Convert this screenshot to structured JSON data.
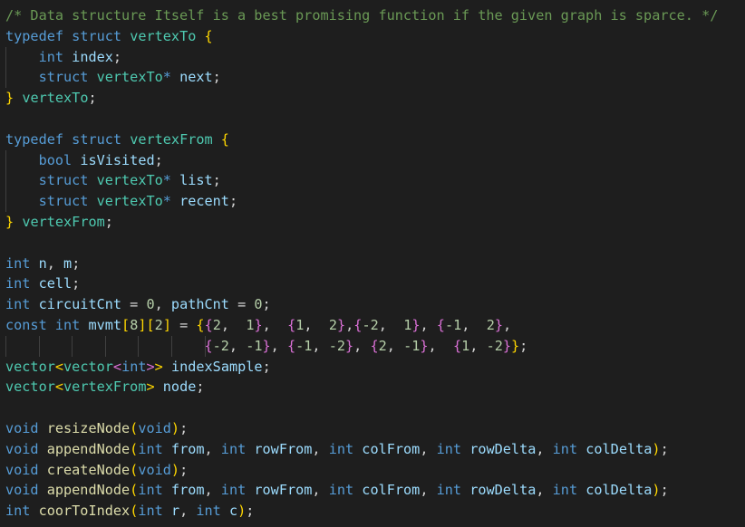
{
  "code": {
    "language": "cpp",
    "lines": [
      {
        "tokens": [
          {
            "c": "comment",
            "t": "/* Data structure Itself is a best promising function if the given graph is sparce. */"
          }
        ]
      },
      {
        "tokens": [
          {
            "c": "kw",
            "t": "typedef"
          },
          {
            "c": "punct",
            "t": " "
          },
          {
            "c": "kw",
            "t": "struct"
          },
          {
            "c": "punct",
            "t": " "
          },
          {
            "c": "type",
            "t": "vertexTo"
          },
          {
            "c": "punct",
            "t": " "
          },
          {
            "c": "b1",
            "t": "{"
          }
        ]
      },
      {
        "guides": [
          1
        ],
        "tokens": [
          {
            "c": "punct",
            "t": "    "
          },
          {
            "c": "kw",
            "t": "int"
          },
          {
            "c": "punct",
            "t": " "
          },
          {
            "c": "ident",
            "t": "index"
          },
          {
            "c": "punct",
            "t": ";"
          }
        ]
      },
      {
        "guides": [
          1
        ],
        "tokens": [
          {
            "c": "punct",
            "t": "    "
          },
          {
            "c": "kw",
            "t": "struct"
          },
          {
            "c": "punct",
            "t": " "
          },
          {
            "c": "type",
            "t": "vertexTo"
          },
          {
            "c": "kw",
            "t": "*"
          },
          {
            "c": "punct",
            "t": " "
          },
          {
            "c": "ident",
            "t": "next"
          },
          {
            "c": "punct",
            "t": ";"
          }
        ]
      },
      {
        "tokens": [
          {
            "c": "b1",
            "t": "}"
          },
          {
            "c": "punct",
            "t": " "
          },
          {
            "c": "type",
            "t": "vertexTo"
          },
          {
            "c": "punct",
            "t": ";"
          }
        ]
      },
      {
        "tokens": []
      },
      {
        "tokens": [
          {
            "c": "kw",
            "t": "typedef"
          },
          {
            "c": "punct",
            "t": " "
          },
          {
            "c": "kw",
            "t": "struct"
          },
          {
            "c": "punct",
            "t": " "
          },
          {
            "c": "type",
            "t": "vertexFrom"
          },
          {
            "c": "punct",
            "t": " "
          },
          {
            "c": "b1",
            "t": "{"
          }
        ]
      },
      {
        "guides": [
          1
        ],
        "tokens": [
          {
            "c": "punct",
            "t": "    "
          },
          {
            "c": "kw",
            "t": "bool"
          },
          {
            "c": "punct",
            "t": " "
          },
          {
            "c": "ident",
            "t": "isVisited"
          },
          {
            "c": "punct",
            "t": ";"
          }
        ]
      },
      {
        "guides": [
          1
        ],
        "tokens": [
          {
            "c": "punct",
            "t": "    "
          },
          {
            "c": "kw",
            "t": "struct"
          },
          {
            "c": "punct",
            "t": " "
          },
          {
            "c": "type",
            "t": "vertexTo"
          },
          {
            "c": "kw",
            "t": "*"
          },
          {
            "c": "punct",
            "t": " "
          },
          {
            "c": "ident",
            "t": "list"
          },
          {
            "c": "punct",
            "t": ";"
          }
        ]
      },
      {
        "guides": [
          1
        ],
        "tokens": [
          {
            "c": "punct",
            "t": "    "
          },
          {
            "c": "kw",
            "t": "struct"
          },
          {
            "c": "punct",
            "t": " "
          },
          {
            "c": "type",
            "t": "vertexTo"
          },
          {
            "c": "kw",
            "t": "*"
          },
          {
            "c": "punct",
            "t": " "
          },
          {
            "c": "ident",
            "t": "recent"
          },
          {
            "c": "punct",
            "t": ";"
          }
        ]
      },
      {
        "tokens": [
          {
            "c": "b1",
            "t": "}"
          },
          {
            "c": "punct",
            "t": " "
          },
          {
            "c": "type",
            "t": "vertexFrom"
          },
          {
            "c": "punct",
            "t": ";"
          }
        ]
      },
      {
        "tokens": []
      },
      {
        "tokens": [
          {
            "c": "kw",
            "t": "int"
          },
          {
            "c": "punct",
            "t": " "
          },
          {
            "c": "ident",
            "t": "n"
          },
          {
            "c": "punct",
            "t": ", "
          },
          {
            "c": "ident",
            "t": "m"
          },
          {
            "c": "punct",
            "t": ";"
          }
        ]
      },
      {
        "tokens": [
          {
            "c": "kw",
            "t": "int"
          },
          {
            "c": "punct",
            "t": " "
          },
          {
            "c": "ident",
            "t": "cell"
          },
          {
            "c": "punct",
            "t": ";"
          }
        ]
      },
      {
        "tokens": [
          {
            "c": "kw",
            "t": "int"
          },
          {
            "c": "punct",
            "t": " "
          },
          {
            "c": "ident",
            "t": "circuitCnt"
          },
          {
            "c": "punct",
            "t": " = "
          },
          {
            "c": "num",
            "t": "0"
          },
          {
            "c": "punct",
            "t": ", "
          },
          {
            "c": "ident",
            "t": "pathCnt"
          },
          {
            "c": "punct",
            "t": " = "
          },
          {
            "c": "num",
            "t": "0"
          },
          {
            "c": "punct",
            "t": ";"
          }
        ]
      },
      {
        "tokens": [
          {
            "c": "kw",
            "t": "const"
          },
          {
            "c": "punct",
            "t": " "
          },
          {
            "c": "kw",
            "t": "int"
          },
          {
            "c": "punct",
            "t": " "
          },
          {
            "c": "ident",
            "t": "mvmt"
          },
          {
            "c": "b1",
            "t": "["
          },
          {
            "c": "num",
            "t": "8"
          },
          {
            "c": "b1",
            "t": "]"
          },
          {
            "c": "b1",
            "t": "["
          },
          {
            "c": "num",
            "t": "2"
          },
          {
            "c": "b1",
            "t": "]"
          },
          {
            "c": "punct",
            "t": " = "
          },
          {
            "c": "b1",
            "t": "{"
          },
          {
            "c": "b2",
            "t": "{"
          },
          {
            "c": "num",
            "t": "2"
          },
          {
            "c": "punct",
            "t": ",  "
          },
          {
            "c": "num",
            "t": "1"
          },
          {
            "c": "b2",
            "t": "}"
          },
          {
            "c": "punct",
            "t": ",  "
          },
          {
            "c": "b2",
            "t": "{"
          },
          {
            "c": "num",
            "t": "1"
          },
          {
            "c": "punct",
            "t": ",  "
          },
          {
            "c": "num",
            "t": "2"
          },
          {
            "c": "b2",
            "t": "}"
          },
          {
            "c": "punct",
            "t": ","
          },
          {
            "c": "b2",
            "t": "{"
          },
          {
            "c": "num",
            "t": "-2"
          },
          {
            "c": "punct",
            "t": ",  "
          },
          {
            "c": "num",
            "t": "1"
          },
          {
            "c": "b2",
            "t": "}"
          },
          {
            "c": "punct",
            "t": ", "
          },
          {
            "c": "b2",
            "t": "{"
          },
          {
            "c": "num",
            "t": "-1"
          },
          {
            "c": "punct",
            "t": ",  "
          },
          {
            "c": "num",
            "t": "2"
          },
          {
            "c": "b2",
            "t": "}"
          },
          {
            "c": "punct",
            "t": ","
          }
        ]
      },
      {
        "guides": [
          1,
          2,
          3,
          4,
          5,
          6,
          7
        ],
        "tokens": [
          {
            "c": "punct",
            "t": "                        "
          },
          {
            "c": "b2",
            "t": "{"
          },
          {
            "c": "num",
            "t": "-2"
          },
          {
            "c": "punct",
            "t": ", "
          },
          {
            "c": "num",
            "t": "-1"
          },
          {
            "c": "b2",
            "t": "}"
          },
          {
            "c": "punct",
            "t": ", "
          },
          {
            "c": "b2",
            "t": "{"
          },
          {
            "c": "num",
            "t": "-1"
          },
          {
            "c": "punct",
            "t": ", "
          },
          {
            "c": "num",
            "t": "-2"
          },
          {
            "c": "b2",
            "t": "}"
          },
          {
            "c": "punct",
            "t": ", "
          },
          {
            "c": "b2",
            "t": "{"
          },
          {
            "c": "num",
            "t": "2"
          },
          {
            "c": "punct",
            "t": ", "
          },
          {
            "c": "num",
            "t": "-1"
          },
          {
            "c": "b2",
            "t": "}"
          },
          {
            "c": "punct",
            "t": ",  "
          },
          {
            "c": "b2",
            "t": "{"
          },
          {
            "c": "num",
            "t": "1"
          },
          {
            "c": "punct",
            "t": ", "
          },
          {
            "c": "num",
            "t": "-2"
          },
          {
            "c": "b2",
            "t": "}"
          },
          {
            "c": "b1",
            "t": "}"
          },
          {
            "c": "punct",
            "t": ";"
          }
        ]
      },
      {
        "tokens": [
          {
            "c": "type",
            "t": "vector"
          },
          {
            "c": "b1",
            "t": "<"
          },
          {
            "c": "type",
            "t": "vector"
          },
          {
            "c": "b2",
            "t": "<"
          },
          {
            "c": "kw",
            "t": "int"
          },
          {
            "c": "b2",
            "t": ">"
          },
          {
            "c": "b1",
            "t": ">"
          },
          {
            "c": "punct",
            "t": " "
          },
          {
            "c": "ident",
            "t": "indexSample"
          },
          {
            "c": "punct",
            "t": ";"
          }
        ]
      },
      {
        "tokens": [
          {
            "c": "type",
            "t": "vector"
          },
          {
            "c": "b1",
            "t": "<"
          },
          {
            "c": "type",
            "t": "vertexFrom"
          },
          {
            "c": "b1",
            "t": ">"
          },
          {
            "c": "punct",
            "t": " "
          },
          {
            "c": "ident",
            "t": "node"
          },
          {
            "c": "punct",
            "t": ";"
          }
        ]
      },
      {
        "tokens": []
      },
      {
        "tokens": [
          {
            "c": "kw",
            "t": "void"
          },
          {
            "c": "punct",
            "t": " "
          },
          {
            "c": "func",
            "t": "resizeNode"
          },
          {
            "c": "b1",
            "t": "("
          },
          {
            "c": "kw",
            "t": "void"
          },
          {
            "c": "b1",
            "t": ")"
          },
          {
            "c": "punct",
            "t": ";"
          }
        ]
      },
      {
        "tokens": [
          {
            "c": "kw",
            "t": "void"
          },
          {
            "c": "punct",
            "t": " "
          },
          {
            "c": "func",
            "t": "appendNode"
          },
          {
            "c": "b1",
            "t": "("
          },
          {
            "c": "kw",
            "t": "int"
          },
          {
            "c": "punct",
            "t": " "
          },
          {
            "c": "ident",
            "t": "from"
          },
          {
            "c": "punct",
            "t": ", "
          },
          {
            "c": "kw",
            "t": "int"
          },
          {
            "c": "punct",
            "t": " "
          },
          {
            "c": "ident",
            "t": "rowFrom"
          },
          {
            "c": "punct",
            "t": ", "
          },
          {
            "c": "kw",
            "t": "int"
          },
          {
            "c": "punct",
            "t": " "
          },
          {
            "c": "ident",
            "t": "colFrom"
          },
          {
            "c": "punct",
            "t": ", "
          },
          {
            "c": "kw",
            "t": "int"
          },
          {
            "c": "punct",
            "t": " "
          },
          {
            "c": "ident",
            "t": "rowDelta"
          },
          {
            "c": "punct",
            "t": ", "
          },
          {
            "c": "kw",
            "t": "int"
          },
          {
            "c": "punct",
            "t": " "
          },
          {
            "c": "ident",
            "t": "colDelta"
          },
          {
            "c": "b1",
            "t": ")"
          },
          {
            "c": "punct",
            "t": ";"
          }
        ]
      },
      {
        "tokens": [
          {
            "c": "kw",
            "t": "void"
          },
          {
            "c": "punct",
            "t": " "
          },
          {
            "c": "func",
            "t": "createNode"
          },
          {
            "c": "b1",
            "t": "("
          },
          {
            "c": "kw",
            "t": "void"
          },
          {
            "c": "b1",
            "t": ")"
          },
          {
            "c": "punct",
            "t": ";"
          }
        ]
      },
      {
        "tokens": [
          {
            "c": "kw",
            "t": "void"
          },
          {
            "c": "punct",
            "t": " "
          },
          {
            "c": "func",
            "t": "appendNode"
          },
          {
            "c": "b1",
            "t": "("
          },
          {
            "c": "kw",
            "t": "int"
          },
          {
            "c": "punct",
            "t": " "
          },
          {
            "c": "ident",
            "t": "from"
          },
          {
            "c": "punct",
            "t": ", "
          },
          {
            "c": "kw",
            "t": "int"
          },
          {
            "c": "punct",
            "t": " "
          },
          {
            "c": "ident",
            "t": "rowFrom"
          },
          {
            "c": "punct",
            "t": ", "
          },
          {
            "c": "kw",
            "t": "int"
          },
          {
            "c": "punct",
            "t": " "
          },
          {
            "c": "ident",
            "t": "colFrom"
          },
          {
            "c": "punct",
            "t": ", "
          },
          {
            "c": "kw",
            "t": "int"
          },
          {
            "c": "punct",
            "t": " "
          },
          {
            "c": "ident",
            "t": "rowDelta"
          },
          {
            "c": "punct",
            "t": ", "
          },
          {
            "c": "kw",
            "t": "int"
          },
          {
            "c": "punct",
            "t": " "
          },
          {
            "c": "ident",
            "t": "colDelta"
          },
          {
            "c": "b1",
            "t": ")"
          },
          {
            "c": "punct",
            "t": ";"
          }
        ]
      },
      {
        "tokens": [
          {
            "c": "kw",
            "t": "int"
          },
          {
            "c": "punct",
            "t": " "
          },
          {
            "c": "func",
            "t": "coorToIndex"
          },
          {
            "c": "b1",
            "t": "("
          },
          {
            "c": "kw",
            "t": "int"
          },
          {
            "c": "punct",
            "t": " "
          },
          {
            "c": "ident",
            "t": "r"
          },
          {
            "c": "punct",
            "t": ", "
          },
          {
            "c": "kw",
            "t": "int"
          },
          {
            "c": "punct",
            "t": " "
          },
          {
            "c": "ident",
            "t": "c"
          },
          {
            "c": "b1",
            "t": ")"
          },
          {
            "c": "punct",
            "t": ";"
          }
        ]
      }
    ]
  },
  "colors": {
    "background": "#1e1e1e",
    "comment": "#6a9955",
    "keyword": "#569cd6",
    "type": "#4ec9b0",
    "identifier": "#9cdcfe",
    "function": "#dcdcaa",
    "number": "#b5cea8",
    "bracket_level_1": "#ffd700",
    "bracket_level_2": "#da70d6"
  }
}
